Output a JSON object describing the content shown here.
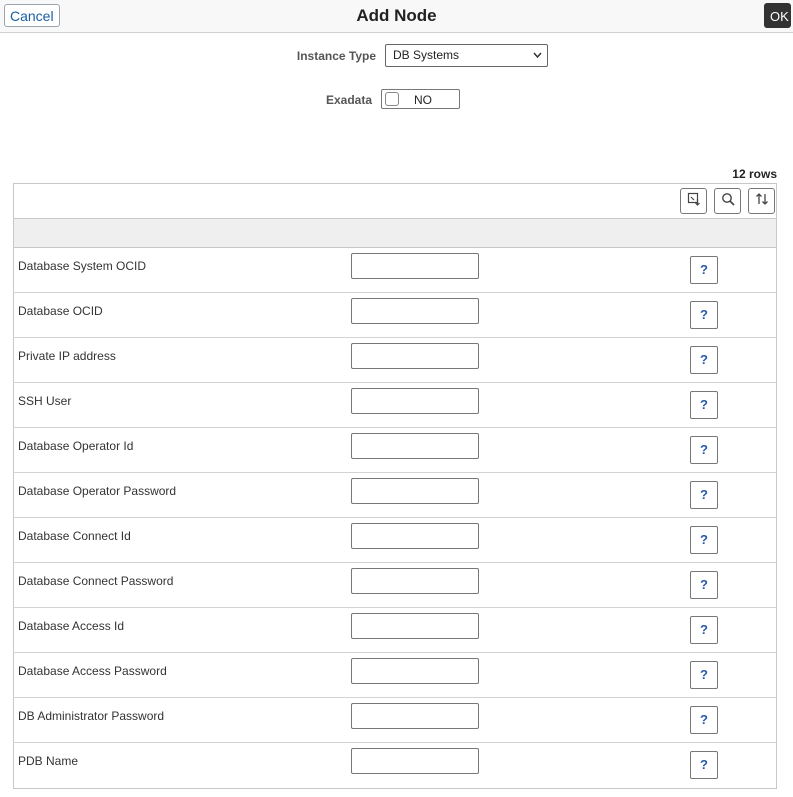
{
  "header": {
    "cancel_label": "Cancel",
    "title": "Add Node",
    "ok_label": "OK"
  },
  "form": {
    "instance_type_label": "Instance Type",
    "instance_type_value": "DB Systems",
    "exadata_label": "Exadata",
    "exadata_value": "NO"
  },
  "grid": {
    "rows_count": "12 rows",
    "toolbar": [
      "download-icon",
      "search-icon",
      "sort-icon"
    ],
    "help_label": "?",
    "rows": [
      {
        "label": "Database System OCID",
        "value": ""
      },
      {
        "label": "Database OCID",
        "value": ""
      },
      {
        "label": "Private IP address",
        "value": ""
      },
      {
        "label": "SSH User",
        "value": ""
      },
      {
        "label": "Database Operator Id",
        "value": ""
      },
      {
        "label": "Database Operator Password",
        "value": ""
      },
      {
        "label": "Database Connect Id",
        "value": ""
      },
      {
        "label": "Database Connect Password",
        "value": ""
      },
      {
        "label": "Database Access Id",
        "value": ""
      },
      {
        "label": "Database Access Password",
        "value": ""
      },
      {
        "label": "DB Administrator Password",
        "value": ""
      },
      {
        "label": "PDB Name",
        "value": ""
      }
    ]
  }
}
